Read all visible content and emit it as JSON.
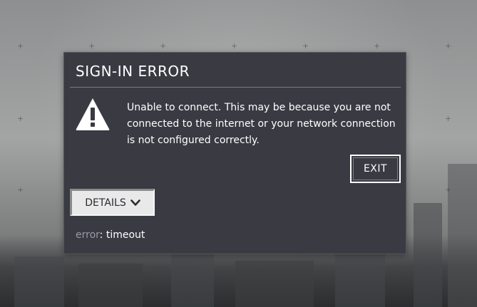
{
  "dialog": {
    "title": "SIGN-IN ERROR",
    "icon": "warning-icon",
    "message": "Unable to connect. This may be because you are not connected to the internet or your network connection is not configured correctly.",
    "exit_label": "EXIT",
    "details_label": "DETAILS",
    "details_icon": "chevron-down-icon",
    "error_key": "error",
    "error_separator": ": ",
    "error_value": "timeout"
  },
  "colors": {
    "dialog_bg": "#3a3a43",
    "text": "#ffffff",
    "error_key": "#9a9aa4",
    "details_bg": "#e9e9e9"
  }
}
